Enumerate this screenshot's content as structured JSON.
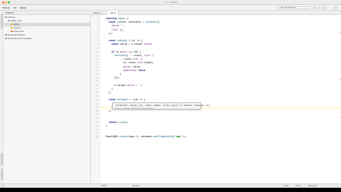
{
  "window": {
    "title": "- […] - react-js",
    "traffic_colors": [
      "#ff5f57",
      "#febc2e",
      "#28c840"
    ]
  },
  "toolbar": {
    "breadcrumb": [
      "react-js",
      "src",
      "App.js"
    ],
    "run_config": "Add Configuration..."
  },
  "project_panel": {
    "header": "Project ▾",
    "tree": [
      {
        "label": "react-js",
        "icon": "folder-icon",
        "color": "#8aa6c1"
      },
      {
        "label": "public_html",
        "icon": "folder-icon",
        "color": "#8aa6c1"
      },
      {
        "label": "App.js",
        "icon": "js-file-icon",
        "color": "#e6b422"
      },
      {
        "label": "index.js",
        "icon": "js-file-icon",
        "color": "#e6b422"
      },
      {
        "label": "index.html",
        "icon": "html-file-icon",
        "color": "#e07b39"
      },
      {
        "label": "External Libraries",
        "icon": "library-icon",
        "color": "#999999"
      },
      {
        "label": "Scratches and Consoles",
        "icon": "scratch-icon",
        "color": "#999999"
      }
    ]
  },
  "editor": {
    "tabs": [
      "index.js",
      "App.js"
    ],
    "code_lines": [
      {
        "n": "1",
        "html": "<span class=\"kw\">function</span> <span class=\"fn\">App</span>() {"
      },
      {
        "n": "2",
        "html": "  <span class=\"kw\">const</span> [state, setState] = <span class=\"fn\">useState</span>({"
      },
      {
        "n": "3",
        "html": "    <span class=\"prop\">value</span>: <span class=\"str\">''</span>,"
      },
      {
        "n": "4",
        "html": "    <span class=\"prop\">list</span>: [],"
      },
      {
        "n": "5",
        "html": "  });"
      },
      {
        "n": "6",
        "html": ""
      },
      {
        "n": "7",
        "html": "  <span class=\"kw\">const</span> <span class=\"fn\">onKeyUp</span> = (e) => {"
      },
      {
        "n": "8",
        "html": "    <span class=\"kw\">const</span> value = e.target.<span class=\"prop\">value</span>;"
      },
      {
        "n": "9",
        "html": ""
      },
      {
        "n": "10",
        "html": "    <span class=\"kw\">if</span> (e.<span class=\"prop\">which</span> === <span class=\"str\">13</span>) {"
      },
      {
        "n": "11",
        "html": "      <span class=\"fn\">setState</span>({ ...state, <span class=\"prop\">list</span>: ["
      },
      {
        "n": "12",
        "html": "          ...state.<span class=\"prop\">list</span>, {"
      },
      {
        "n": "13",
        "html": "            <span class=\"prop\">id</span>: state.<span class=\"prop\">list</span>.length,"
      },
      {
        "n": "14",
        "html": "            <span class=\"prop\">value</span>: value,"
      },
      {
        "n": "15",
        "html": "            <span class=\"prop\">completed</span>: <span class=\"kw\">false</span>"
      },
      {
        "n": "16",
        "html": "          }"
      },
      {
        "n": "17",
        "html": "      ]});"
      },
      {
        "n": "18",
        "html": ""
      },
      {
        "n": "19",
        "html": "      e.target.<span class=\"prop\">value</span> = <span class=\"str\">''</span>;"
      },
      {
        "n": "20",
        "html": "    }"
      },
      {
        "n": "21",
        "html": "  };"
      },
      {
        "n": "22",
        "html": ""
      },
      {
        "n": "23",
        "html": "  <span class=\"kw\">const</span> <span class=\"fn\">onToggle</span> = (id) => {"
      },
      {
        "n": "24",
        "html": ""
      },
      {
        "n": "25",
        "html": "    <span class=\"fn\">setState</span>({ ...state, <span class=\"prop\">list</span>: state.<span class=\"prop\">list</span>.map(item => ...) });"
      },
      {
        "n": "26",
        "html": "  };"
      },
      {
        "n": "27",
        "html": ""
      },
      {
        "n": "28",
        "html": ""
      },
      {
        "n": "29",
        "html": "  <span class=\"kw\">return</span> (<span class=\"fn\">view</span>);"
      },
      {
        "n": "30",
        "html": "}"
      },
      {
        "n": "31",
        "html": ""
      },
      {
        "n": "32",
        "html": ""
      },
      {
        "n": "33",
        "html": "ReactDOM.<span class=\"fn\">render</span>(&lt;App /&gt;, document.<span class=\"fn\">getElementById</span>(<span class=\"str\">'app'</span>));"
      }
    ],
    "current_line": "25"
  },
  "tooltip": {
    "signature": "callbackfn: (value: any, index: number, array: any[]) => unknown, thisArg?: any",
    "hint": "Press ⇧ to navigate · ⌘P to show parameter hints"
  },
  "status": {
    "left_tabs": [
      "TODO",
      "Terminal"
    ],
    "event_log": "Event Log",
    "position": "25:31",
    "encoding": "UTF-8"
  }
}
